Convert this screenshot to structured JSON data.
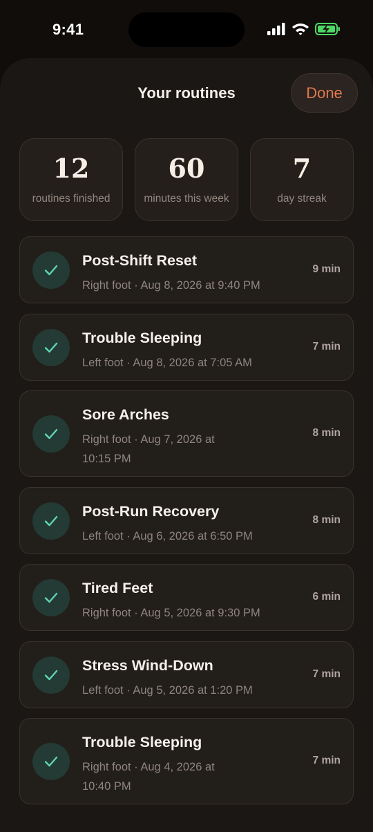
{
  "status_bar": {
    "time": "9:41"
  },
  "header": {
    "title": "Your routines",
    "done_label": "Done"
  },
  "stats": [
    {
      "value": "12",
      "label": "routines finished"
    },
    {
      "value": "60",
      "label": "minutes this week"
    },
    {
      "value": "7",
      "label": "day streak"
    }
  ],
  "routines": [
    {
      "title": "Post-Shift Reset",
      "meta": "Right foot · Aug 8, 2026 at 9:40 PM",
      "duration": "9 min"
    },
    {
      "title": "Trouble Sleeping",
      "meta": "Left foot · Aug 8, 2026 at 7:05 AM",
      "duration": "7 min"
    },
    {
      "title": "Sore Arches",
      "meta": "Right foot · Aug 7, 2026 at 10:15 PM",
      "duration": "8 min"
    },
    {
      "title": "Post-Run Recovery",
      "meta": "Left foot · Aug 6, 2026 at 6:50 PM",
      "duration": "8 min"
    },
    {
      "title": "Tired Feet",
      "meta": "Right foot · Aug 5, 2026 at 9:30 PM",
      "duration": "6 min"
    },
    {
      "title": "Stress Wind-Down",
      "meta": "Left foot · Aug 5, 2026 at 1:20 PM",
      "duration": "7 min"
    },
    {
      "title": "Trouble Sleeping",
      "meta": "Right foot · Aug 4, 2026 at 10:40 PM",
      "duration": "7 min"
    }
  ],
  "colors": {
    "background": "#110d0b",
    "sheet": "#1b1714",
    "accent": "#e0784f",
    "check": "#5fd6b6",
    "battery": "#4cd964"
  }
}
